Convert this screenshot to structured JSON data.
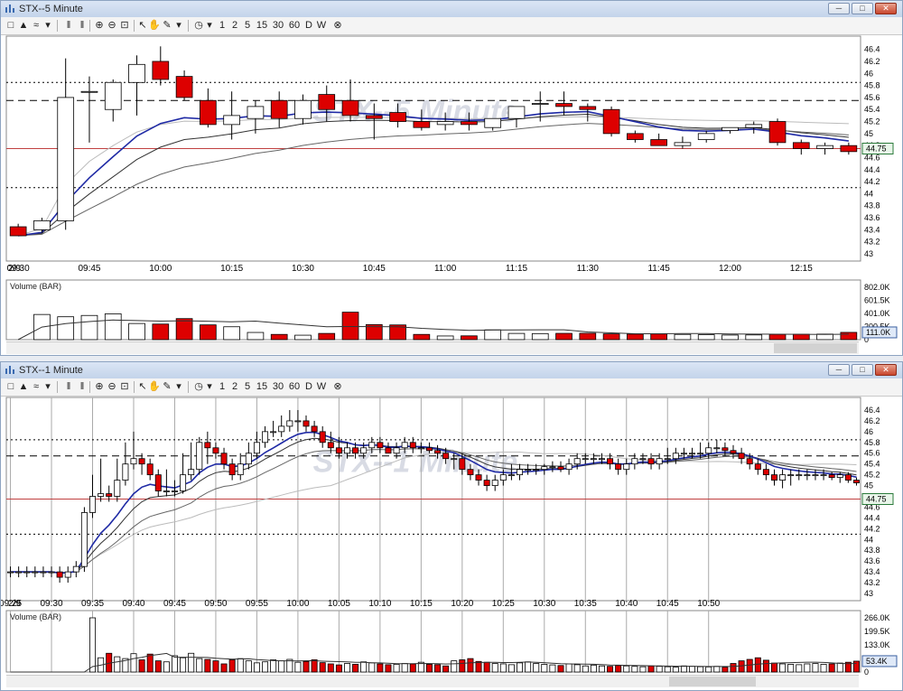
{
  "windows": [
    {
      "title": "STX--5 Minute",
      "watermark": "STX--5 Minute",
      "date_tag": "2/9",
      "price_label": "44.75",
      "volume_title": "Volume (BAR)",
      "volume_label": "111.0K",
      "price_ticks": [
        "46.4",
        "46.2",
        "46",
        "45.8",
        "45.6",
        "45.4",
        "45.2",
        "45",
        "44.8",
        "44.6",
        "44.4",
        "44.2",
        "44",
        "43.8",
        "43.6",
        "43.4",
        "43.2",
        "43"
      ],
      "volume_ticks": [
        "802.0K",
        "601.5K",
        "401.0K",
        "200.5K",
        "0"
      ],
      "time_ticks": [
        "09:30",
        "09:45",
        "10:00",
        "10:15",
        "10:30",
        "10:45",
        "11:00",
        "11:15",
        "11:30",
        "11:45",
        "12:00",
        "12:15"
      ]
    },
    {
      "title": "STX--1 Minute",
      "watermark": "STX--1 Minute",
      "date_tag": "2/9",
      "price_label": "44.75",
      "volume_title": "Volume (BAR)",
      "volume_label": "53.4K",
      "price_ticks": [
        "46.4",
        "46.2",
        "46",
        "45.8",
        "45.6",
        "45.4",
        "45.2",
        "45",
        "44.8",
        "44.6",
        "44.4",
        "44.2",
        "44",
        "43.8",
        "43.6",
        "43.4",
        "43.2",
        "43"
      ],
      "volume_ticks": [
        "266.0K",
        "199.5K",
        "133.0K",
        "66.5K",
        "0"
      ],
      "time_ticks": [
        "09:25",
        "09:30",
        "09:35",
        "09:40",
        "09:45",
        "09:50",
        "09:55",
        "10:00",
        "10:05",
        "10:10",
        "10:15",
        "10:20",
        "10:25",
        "10:30",
        "10:35",
        "10:40",
        "10:45",
        "10:50"
      ]
    }
  ],
  "toolbar": {
    "periods": [
      "1",
      "2",
      "5",
      "15",
      "30",
      "60",
      "D",
      "W"
    ]
  },
  "chart_data": [
    {
      "type": "candlestick",
      "title": "STX--5 Minute",
      "interval": "5 Minute",
      "ylim": [
        43,
        46.5
      ],
      "volume_ylim": [
        0,
        802000
      ],
      "reference_lines": {
        "last_price": 44.75,
        "dashed": 45.55,
        "dotted": [
          45.85,
          44.1
        ]
      },
      "x": [
        "09:25",
        "09:30",
        "09:35",
        "09:40",
        "09:45",
        "09:50",
        "09:55",
        "10:00",
        "10:05",
        "10:10",
        "10:15",
        "10:20",
        "10:25",
        "10:30",
        "10:35",
        "10:40",
        "10:45",
        "10:50",
        "10:55",
        "11:00",
        "11:05",
        "11:10",
        "11:15",
        "11:20",
        "11:25",
        "11:30",
        "11:35",
        "11:40",
        "11:45",
        "11:50",
        "11:55",
        "12:00",
        "12:05",
        "12:10",
        "12:15",
        "12:20"
      ],
      "open": [
        43.45,
        43.4,
        43.55,
        45.7,
        45.4,
        45.85,
        46.2,
        45.95,
        45.55,
        45.15,
        45.25,
        45.55,
        45.25,
        45.65,
        45.55,
        45.3,
        45.35,
        45.2,
        45.15,
        45.2,
        45.1,
        45.25,
        45.5,
        45.5,
        45.45,
        45.4,
        45.0,
        44.9,
        44.8,
        44.9,
        45.05,
        45.1,
        45.2,
        44.85,
        44.75,
        44.8
      ],
      "high": [
        43.5,
        43.6,
        46.25,
        45.95,
        45.9,
        46.3,
        46.45,
        46.05,
        45.75,
        45.7,
        45.55,
        45.7,
        45.65,
        45.8,
        45.9,
        45.5,
        45.5,
        45.4,
        45.35,
        45.35,
        45.25,
        45.45,
        45.7,
        45.7,
        45.5,
        45.45,
        45.05,
        45.0,
        44.95,
        45.05,
        45.1,
        45.2,
        45.25,
        44.9,
        44.85,
        44.85
      ],
      "low": [
        43.3,
        43.35,
        43.4,
        44.85,
        45.2,
        45.3,
        45.8,
        45.55,
        45.1,
        44.9,
        45.0,
        45.1,
        45.15,
        45.2,
        45.2,
        44.9,
        45.1,
        45.05,
        45.05,
        45.05,
        45.05,
        45.1,
        45.2,
        45.3,
        45.2,
        44.95,
        44.85,
        44.8,
        44.75,
        44.85,
        45.0,
        45.0,
        44.8,
        44.65,
        44.65,
        44.65
      ],
      "close": [
        43.3,
        43.55,
        45.6,
        45.7,
        45.85,
        46.15,
        45.9,
        45.6,
        45.15,
        45.3,
        45.45,
        45.25,
        45.55,
        45.4,
        45.3,
        45.25,
        45.2,
        45.1,
        45.2,
        45.15,
        45.25,
        45.45,
        45.5,
        45.45,
        45.4,
        45.0,
        44.9,
        44.8,
        44.85,
        45.0,
        45.1,
        45.15,
        44.85,
        44.75,
        44.8,
        44.7
      ],
      "volume": [
        0,
        385000,
        350000,
        370000,
        395000,
        247000,
        238000,
        322000,
        226000,
        197000,
        110000,
        80000,
        68000,
        95000,
        420000,
        230000,
        225000,
        80000,
        56000,
        58000,
        150000,
        95000,
        92000,
        96000,
        97000,
        88000,
        85000,
        87000,
        80000,
        75000,
        70000,
        72000,
        80000,
        82000,
        85000,
        111000
      ]
    },
    {
      "type": "candlestick",
      "title": "STX--1 Minute",
      "interval": "1 Minute",
      "ylim": [
        43,
        46.5
      ],
      "volume_ylim": [
        0,
        266000
      ],
      "reference_lines": {
        "last_price": 44.75,
        "dashed": 45.55,
        "dotted": [
          45.85,
          44.1
        ]
      },
      "x_start": "09:25",
      "x_step_minutes": 1,
      "open": [
        43.4,
        43.4,
        43.4,
        43.4,
        43.4,
        43.4,
        43.4,
        43.3,
        43.4,
        43.5,
        44.5,
        44.8,
        44.85,
        44.8,
        45.1,
        45.4,
        45.5,
        45.4,
        45.2,
        44.9,
        44.9,
        44.9,
        45.2,
        45.3,
        45.8,
        45.7,
        45.6,
        45.4,
        45.2,
        45.4,
        45.6,
        45.8,
        46.0,
        46.0,
        46.1,
        46.2,
        46.2,
        46.1,
        46.0,
        45.8,
        45.7,
        45.6,
        45.7,
        45.6,
        45.7,
        45.8,
        45.7,
        45.6,
        45.7,
        45.8,
        45.7,
        45.7,
        45.65,
        45.6,
        45.5,
        45.5,
        45.3,
        45.2,
        45.1,
        45.0,
        45.1,
        45.2,
        45.2,
        45.3,
        45.3,
        45.3,
        45.35,
        45.35,
        45.3,
        45.4,
        45.5,
        45.5,
        45.5,
        45.5,
        45.4,
        45.3,
        45.4,
        45.5,
        45.5,
        45.4,
        45.5,
        45.5,
        45.6,
        45.6,
        45.6,
        45.6,
        45.7,
        45.7,
        45.65,
        45.6,
        45.5,
        45.4,
        45.3,
        45.2,
        45.1,
        45.2,
        45.2,
        45.2,
        45.2,
        45.2,
        45.2,
        45.15,
        45.2,
        45.1
      ],
      "high": [
        43.5,
        43.5,
        43.5,
        43.5,
        43.5,
        43.5,
        43.5,
        43.5,
        43.6,
        44.6,
        45.2,
        45.5,
        45.0,
        45.5,
        45.8,
        46.0,
        45.6,
        45.5,
        45.3,
        45.3,
        45.1,
        45.6,
        45.8,
        45.9,
        46.0,
        45.8,
        45.7,
        45.5,
        45.6,
        45.8,
        46.0,
        46.1,
        46.2,
        46.3,
        46.4,
        46.4,
        46.3,
        46.2,
        46.1,
        46.0,
        45.9,
        45.8,
        45.8,
        45.8,
        45.9,
        45.9,
        45.8,
        45.8,
        45.9,
        45.9,
        45.8,
        45.8,
        45.75,
        45.7,
        45.6,
        45.6,
        45.4,
        45.3,
        45.2,
        45.2,
        45.3,
        45.4,
        45.4,
        45.4,
        45.4,
        45.4,
        45.45,
        45.45,
        45.5,
        45.6,
        45.6,
        45.6,
        45.6,
        45.6,
        45.5,
        45.5,
        45.6,
        45.6,
        45.6,
        45.6,
        45.7,
        45.7,
        45.7,
        45.7,
        45.8,
        45.8,
        45.85,
        45.8,
        45.75,
        45.7,
        45.6,
        45.5,
        45.4,
        45.3,
        45.3,
        45.3,
        45.3,
        45.3,
        45.3,
        45.3,
        45.25,
        45.25,
        45.25,
        45.15
      ],
      "low": [
        43.3,
        43.3,
        43.3,
        43.3,
        43.3,
        43.3,
        43.2,
        43.2,
        43.3,
        43.4,
        44.4,
        44.7,
        44.7,
        44.7,
        45.0,
        45.3,
        45.2,
        45.1,
        44.8,
        44.8,
        44.8,
        44.85,
        45.1,
        45.2,
        45.4,
        45.5,
        45.3,
        45.1,
        45.1,
        45.3,
        45.5,
        45.7,
        45.9,
        45.9,
        46.0,
        46.0,
        46.0,
        45.9,
        45.7,
        45.6,
        45.5,
        45.5,
        45.5,
        45.5,
        45.6,
        45.6,
        45.6,
        45.5,
        45.6,
        45.6,
        45.6,
        45.6,
        45.5,
        45.4,
        45.3,
        45.2,
        45.1,
        45.0,
        44.9,
        44.9,
        45.0,
        45.1,
        45.1,
        45.2,
        45.2,
        45.2,
        45.25,
        45.25,
        45.2,
        45.3,
        45.4,
        45.4,
        45.4,
        45.3,
        45.2,
        45.2,
        45.3,
        45.4,
        45.3,
        45.3,
        45.4,
        45.4,
        45.5,
        45.5,
        45.5,
        45.5,
        45.6,
        45.55,
        45.5,
        45.4,
        45.3,
        45.2,
        45.1,
        45.0,
        44.95,
        45.0,
        45.1,
        45.1,
        45.1,
        45.1,
        45.1,
        45.05,
        45.05,
        45.0
      ],
      "close": [
        43.4,
        43.4,
        43.4,
        43.4,
        43.4,
        43.4,
        43.3,
        43.4,
        43.5,
        44.5,
        44.8,
        44.85,
        44.8,
        45.1,
        45.4,
        45.5,
        45.4,
        45.2,
        44.9,
        44.9,
        44.9,
        45.2,
        45.3,
        45.8,
        45.7,
        45.6,
        45.4,
        45.2,
        45.4,
        45.6,
        45.8,
        46.0,
        46.0,
        46.1,
        46.2,
        46.2,
        46.1,
        46.0,
        45.8,
        45.7,
        45.6,
        45.7,
        45.6,
        45.7,
        45.8,
        45.7,
        45.6,
        45.7,
        45.8,
        45.7,
        45.7,
        45.65,
        45.6,
        45.5,
        45.5,
        45.3,
        45.2,
        45.1,
        45.0,
        45.1,
        45.2,
        45.2,
        45.3,
        45.3,
        45.3,
        45.35,
        45.35,
        45.3,
        45.4,
        45.5,
        45.5,
        45.5,
        45.5,
        45.4,
        45.3,
        45.4,
        45.5,
        45.5,
        45.4,
        45.5,
        45.5,
        45.6,
        45.6,
        45.6,
        45.6,
        45.7,
        45.7,
        45.65,
        45.6,
        45.5,
        45.4,
        45.3,
        45.2,
        45.1,
        45.2,
        45.2,
        45.2,
        45.2,
        45.2,
        45.2,
        45.15,
        45.2,
        45.1,
        45.05
      ],
      "volume": [
        0,
        0,
        0,
        0,
        0,
        0,
        0,
        0,
        0,
        0,
        266000,
        70000,
        92000,
        75000,
        66000,
        90000,
        60000,
        88000,
        55000,
        50000,
        80000,
        70000,
        92000,
        66000,
        62000,
        55000,
        40000,
        60000,
        66000,
        55000,
        45000,
        50000,
        60000,
        55000,
        62000,
        48000,
        52000,
        60000,
        46000,
        40000,
        35000,
        42000,
        38000,
        50000,
        45000,
        40000,
        36000,
        38000,
        42000,
        40000,
        48000,
        38000,
        36000,
        30000,
        55000,
        60000,
        66000,
        52000,
        48000,
        42000,
        40000,
        36000,
        45000,
        50000,
        42000,
        38000,
        35000,
        32000,
        40000,
        36000,
        30000,
        34000,
        30000,
        28000,
        32000,
        30000,
        28000,
        26000,
        30000,
        28000,
        26000,
        24000,
        30000,
        28000,
        26000,
        25000,
        28000,
        24000,
        42000,
        55000,
        62000,
        70000,
        58000,
        44000,
        40000,
        38000,
        36000,
        40000,
        42000,
        38000,
        40000,
        44000,
        48000,
        53400
      ]
    }
  ],
  "colors": {
    "down": "#dd0000",
    "up": "#ffffff",
    "ma_fast": "#1f2aa5",
    "ma_mid": "#333333",
    "ma_slow": "#bbbbbb",
    "last_price_line": "#c04040"
  }
}
